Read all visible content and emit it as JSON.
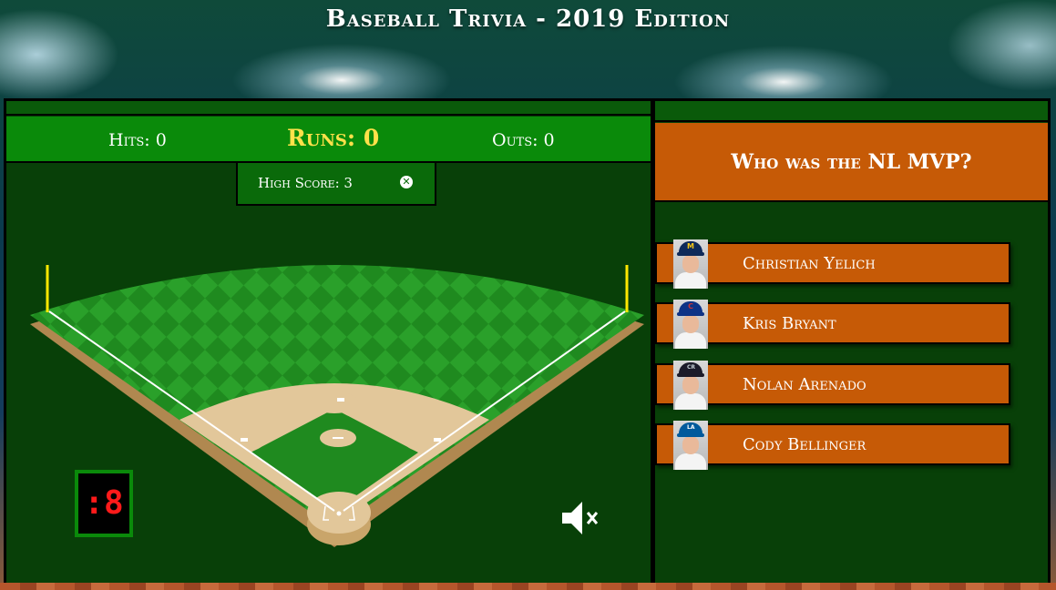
{
  "title": "Baseball Trivia - 2019 Edition",
  "scoreboard": {
    "hits": "Hits: 0",
    "runs": "Runs: 0",
    "outs": "Outs: 0"
  },
  "high_score": {
    "text": "High Score: 3",
    "close_icon": "close-circle-icon"
  },
  "timer": ":8",
  "sound": {
    "icon": "speaker-muted-icon"
  },
  "quiz": {
    "question": "Who was the NL MVP?",
    "answers": [
      {
        "label": "Christian Yelich",
        "cap_color": "#0e2a5a",
        "logo": "M"
      },
      {
        "label": "Kris Bryant",
        "cap_color": "#0e3386",
        "logo": "C"
      },
      {
        "label": "Nolan Arenado",
        "cap_color": "#1b1b2a",
        "logo": "CR"
      },
      {
        "label": "Cody Bellinger",
        "cap_color": "#005a9c",
        "logo": "LA"
      }
    ]
  },
  "colors": {
    "panel_green": "#084008",
    "score_green": "#0a8a0a",
    "runs_yellow": "#ffe14a",
    "answer_orange": "#c65a06",
    "timer_red": "#ff1a1a"
  }
}
